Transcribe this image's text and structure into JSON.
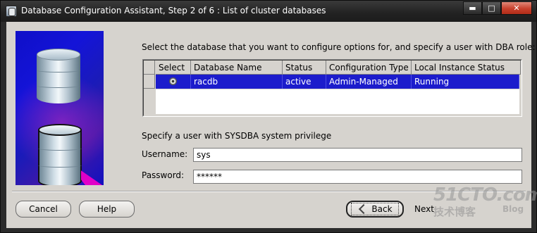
{
  "window": {
    "title": "Database Configuration Assistant, Step 2 of 6 : List of cluster databases",
    "controls": {
      "minimize": "▬",
      "maximize": "□",
      "close": "✕"
    }
  },
  "instruction": "Select the database that you want to configure options for, and specify a user with DBA role:",
  "table": {
    "columns": [
      "Select",
      "Database Name",
      "Status",
      "Configuration Type",
      "Local Instance Status"
    ],
    "rows": [
      {
        "selected": true,
        "database_name": "racdb",
        "status": "active",
        "configuration_type": "Admin-Managed",
        "local_instance_status": "Running"
      }
    ]
  },
  "sysdba_label": "Specify a user with SYSDBA system privilege",
  "username": {
    "label": "Username:",
    "value": "sys"
  },
  "password": {
    "label": "Password:",
    "value": "******"
  },
  "buttons": {
    "cancel": "Cancel",
    "help": "Help",
    "back": "Back",
    "next": "Next"
  },
  "watermark": {
    "site": "51CTO.com",
    "tagline": "技术博客",
    "blog": "Blog"
  },
  "colors": {
    "selection": "#1c1ccc",
    "dialog_bg": "#d6d3ce",
    "titlebar": "#222222"
  }
}
